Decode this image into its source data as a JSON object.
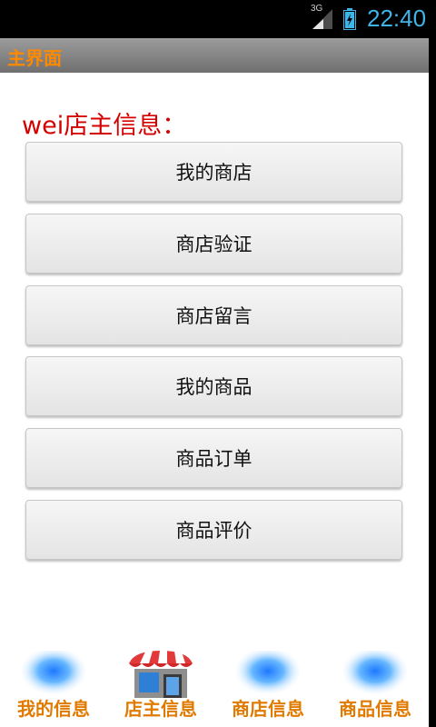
{
  "status_bar": {
    "network": "3G",
    "time": "22:40",
    "icons": [
      "signal-icon",
      "battery-icon"
    ]
  },
  "app_bar": {
    "title": "主界面"
  },
  "main": {
    "heading": "wei店主信息：",
    "buttons": [
      "我的商店",
      "商店验证",
      "商店留言",
      "我的商品",
      "商品订单",
      "商品评价"
    ]
  },
  "bottom_nav": {
    "items": [
      {
        "label": "我的信息",
        "icon": "blue-glow-icon"
      },
      {
        "label": "店主信息",
        "icon": "storefront-icon"
      },
      {
        "label": "商店信息",
        "icon": "blue-glow-icon"
      },
      {
        "label": "商品信息",
        "icon": "blue-glow-icon"
      }
    ]
  },
  "colors": {
    "accent_orange": "#ff8a00",
    "heading_red": "#d40000",
    "status_blue": "#3fb4e6"
  }
}
